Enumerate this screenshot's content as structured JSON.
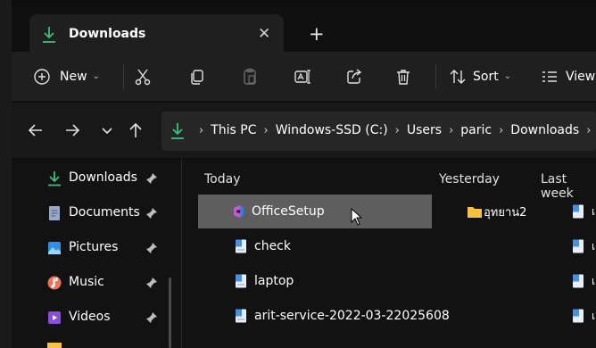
{
  "window": {
    "tab_title": "Downloads",
    "close_glyph": "✕",
    "new_tab_glyph": "+"
  },
  "toolbar": {
    "new_label": "New",
    "sort_label": "Sort",
    "view_label": "View",
    "icons": [
      "add-icon",
      "cut-icon",
      "copy-icon",
      "paste-icon",
      "rename-icon",
      "share-icon",
      "delete-icon",
      "sort-icon",
      "view-icon"
    ]
  },
  "address": {
    "crumbs": [
      "This PC",
      "Windows-SSD (C:)",
      "Users",
      "paric",
      "Downloads"
    ]
  },
  "sidebar": {
    "items": [
      {
        "label": "Downloads",
        "icon": "download-icon",
        "pinned": true
      },
      {
        "label": "Documents",
        "icon": "document-icon",
        "pinned": true
      },
      {
        "label": "Pictures",
        "icon": "picture-icon",
        "pinned": true
      },
      {
        "label": "Music",
        "icon": "music-icon",
        "pinned": true
      },
      {
        "label": "Videos",
        "icon": "video-icon",
        "pinned": true
      }
    ]
  },
  "groups": {
    "today": {
      "label": "Today",
      "files": [
        "OfficeSetup",
        "check",
        "laptop",
        "arit-service-2022-03-22025608"
      ]
    },
    "yesterday": {
      "label": "Yesterday",
      "files": [
        "อุทยาน2"
      ]
    },
    "last_week": {
      "label": "Last week",
      "files": [
        "เอ",
        "เอ",
        "เอ",
        "เอ"
      ]
    }
  },
  "colors": {
    "download_accent": "#3dbd7d",
    "folder_yellow": "#f5c242",
    "selection": "#5e5e5e",
    "doc_blue": "#4a8fe0"
  }
}
